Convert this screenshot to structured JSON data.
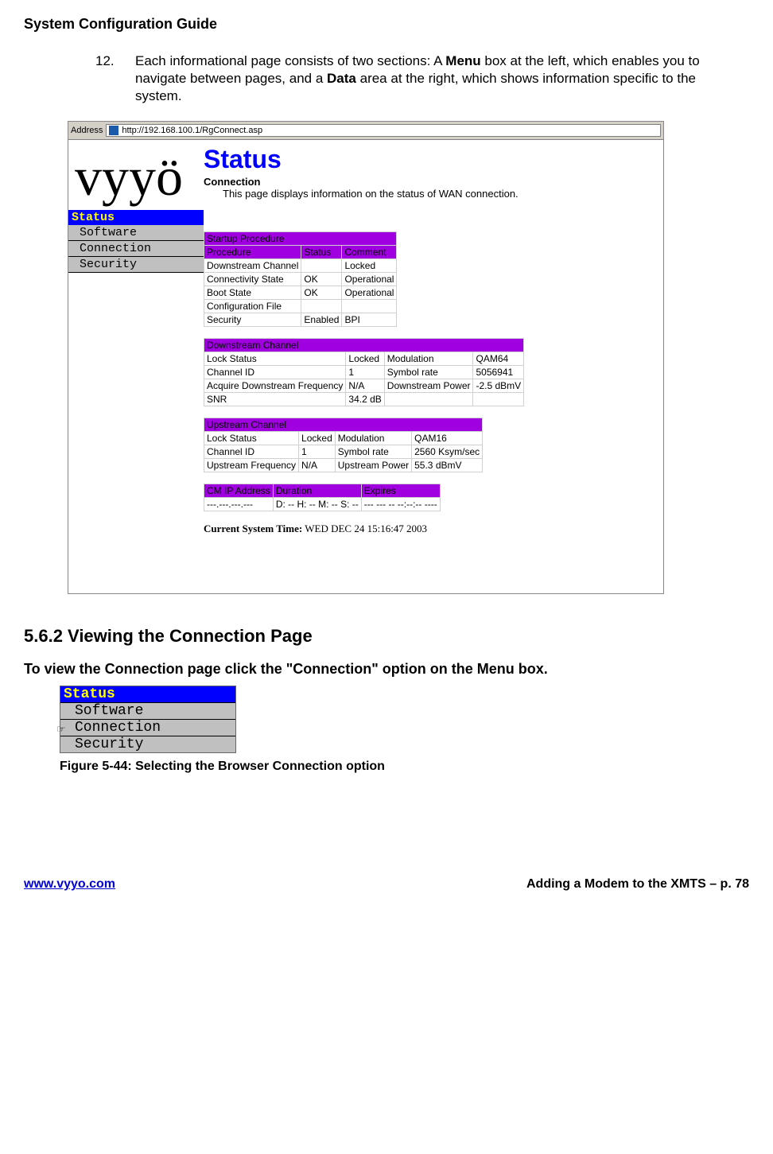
{
  "page": {
    "header": "System Configuration Guide",
    "item": {
      "num": "12.",
      "text_pre": "Each informational page consists of two sections: A ",
      "menu_w": "Menu",
      "text_mid": " box at the left, which enables you to navigate between pages, and a ",
      "data_w": "Data",
      "text_post": " area at the right, which shows information specific to the system."
    }
  },
  "browser": {
    "address_label": "Address",
    "url": "http://192.168.100.1/RgConnect.asp",
    "logo": "vyyö",
    "menu": {
      "header": "Status",
      "items": [
        "Software",
        "Connection",
        "Security"
      ]
    },
    "status": {
      "title": "Status",
      "subtitle": "Connection",
      "description": "This page displays information on the status of WAN connection."
    },
    "startup": {
      "header": "Startup Procedure",
      "cols": [
        "Procedure",
        "Status",
        "Comment"
      ],
      "rows": [
        [
          "Downstream Channel",
          "",
          "Locked"
        ],
        [
          "Connectivity State",
          "OK",
          "Operational"
        ],
        [
          "Boot State",
          "OK",
          "Operational"
        ],
        [
          "Configuration File",
          "",
          ""
        ],
        [
          "Security",
          "Enabled",
          "BPI"
        ]
      ]
    },
    "downstream": {
      "header": "Downstream Channel",
      "rows": [
        [
          "Lock Status",
          "Locked",
          "Modulation",
          "QAM64"
        ],
        [
          "Channel ID",
          "1",
          "Symbol rate",
          "5056941"
        ],
        [
          "Acquire Downstream Frequency",
          "N/A",
          "Downstream Power",
          "-2.5 dBmV"
        ],
        [
          "SNR",
          "34.2 dB",
          "",
          ""
        ]
      ]
    },
    "upstream": {
      "header": "Upstream Channel",
      "rows": [
        [
          "Lock Status",
          "Locked",
          "Modulation",
          "QAM16"
        ],
        [
          "Channel ID",
          "1",
          "Symbol rate",
          "2560 Ksym/sec"
        ],
        [
          "Upstream Frequency",
          "N/A",
          "Upstream Power",
          "55.3 dBmV"
        ]
      ]
    },
    "cmip": {
      "cols": [
        "CM IP Address",
        "Duration",
        "Expires"
      ],
      "row": [
        "---.---.---.---",
        "D: -- H: -- M: -- S: --",
        "--- --- -- --:--:-- ----"
      ]
    },
    "systime": {
      "label": "Current System Time:",
      "value": "WED DEC 24 15:16:47 2003"
    }
  },
  "section562": {
    "heading": "5.6.2 Viewing the Connection Page",
    "instruction": "To view the Connection page click the \"Connection\" option on the Menu box.",
    "menu": {
      "header": "Status",
      "items": [
        "Software",
        "Connection",
        "Security"
      ]
    },
    "caption": "Figure 5-44: Selecting the Browser Connection option"
  },
  "footer": {
    "url": "www.vyyo.com",
    "right": "Adding a Modem to the XMTS – p. 78"
  }
}
